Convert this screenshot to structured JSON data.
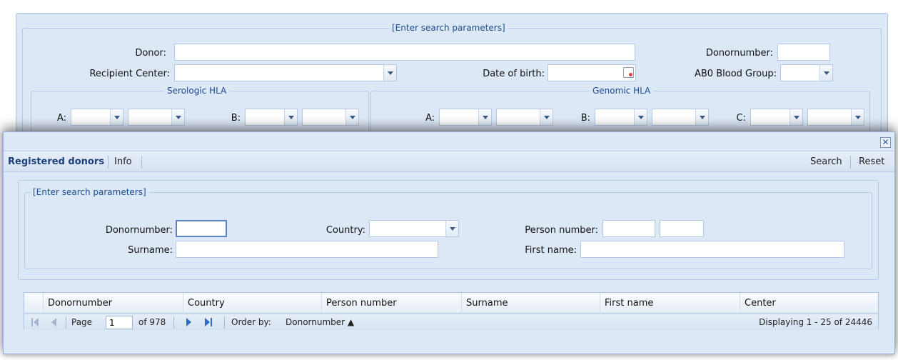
{
  "background_form": {
    "legend": "[Enter search parameters]",
    "donor_label": "Donor:",
    "donor_value": "",
    "donornumber_label": "Donornumber:",
    "donornumber_value": "",
    "recipient_center_label": "Recipient Center:",
    "recipient_center_value": "",
    "date_of_birth_label": "Date of birth:",
    "date_of_birth_value": "",
    "ab0_label": "AB0 Blood Group:",
    "ab0_value": "",
    "serologic_legend": "Serologic HLA",
    "genomic_legend": "Genomic HLA",
    "ser_a_label": "A:",
    "ser_b_label": "B:",
    "gen_a_label": "A:",
    "gen_b_label": "B:",
    "gen_c_label": "C:"
  },
  "modal": {
    "close_icon": "close-icon",
    "tabs": [
      {
        "label": "Registered donors",
        "active": true
      },
      {
        "label": "Info",
        "active": false
      }
    ],
    "toolbar_right": {
      "search_label": "Search",
      "reset_label": "Reset"
    },
    "search_panel": {
      "legend": "[Enter search parameters]",
      "donornumber_label": "Donornumber:",
      "donornumber_value": "",
      "country_label": "Country:",
      "country_value": "",
      "person_number_label": "Person number:",
      "person_number_value_1": "",
      "person_number_value_2": "",
      "surname_label": "Surname:",
      "surname_value": "",
      "first_name_label": "First name:",
      "first_name_value": ""
    },
    "grid": {
      "columns": [
        "Donornumber",
        "Country",
        "Person number",
        "Surname",
        "First name",
        "Center"
      ],
      "rows": [],
      "pager": {
        "page_label": "Page",
        "page_value": "1",
        "of_label": "of 978",
        "order_by_label": "Order by:",
        "order_by_value": "Donornumber ▲",
        "displaying": "Displaying 1 - 25 of 24446"
      }
    }
  },
  "colors": {
    "panel_background": "#dde8f6",
    "border": "#a9c2e3",
    "legend_text": "#1a4b8f",
    "accent": "#2d6bc4"
  }
}
